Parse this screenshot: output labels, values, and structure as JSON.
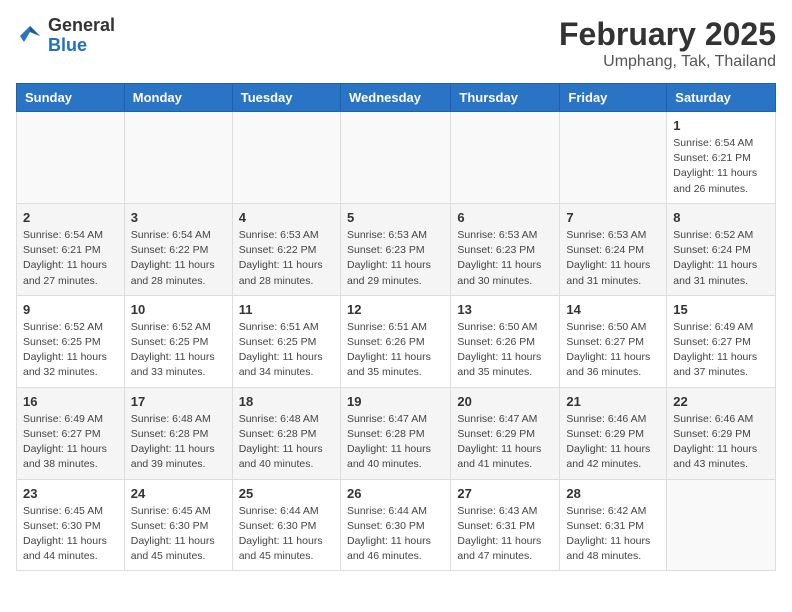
{
  "logo": {
    "general": "General",
    "blue": "Blue"
  },
  "title": "February 2025",
  "subtitle": "Umphang, Tak, Thailand",
  "days_of_week": [
    "Sunday",
    "Monday",
    "Tuesday",
    "Wednesday",
    "Thursday",
    "Friday",
    "Saturday"
  ],
  "weeks": [
    [
      {
        "day": "",
        "info": ""
      },
      {
        "day": "",
        "info": ""
      },
      {
        "day": "",
        "info": ""
      },
      {
        "day": "",
        "info": ""
      },
      {
        "day": "",
        "info": ""
      },
      {
        "day": "",
        "info": ""
      },
      {
        "day": "1",
        "info": "Sunrise: 6:54 AM\nSunset: 6:21 PM\nDaylight: 11 hours and 26 minutes."
      }
    ],
    [
      {
        "day": "2",
        "info": "Sunrise: 6:54 AM\nSunset: 6:21 PM\nDaylight: 11 hours and 27 minutes."
      },
      {
        "day": "3",
        "info": "Sunrise: 6:54 AM\nSunset: 6:22 PM\nDaylight: 11 hours and 28 minutes."
      },
      {
        "day": "4",
        "info": "Sunrise: 6:53 AM\nSunset: 6:22 PM\nDaylight: 11 hours and 28 minutes."
      },
      {
        "day": "5",
        "info": "Sunrise: 6:53 AM\nSunset: 6:23 PM\nDaylight: 11 hours and 29 minutes."
      },
      {
        "day": "6",
        "info": "Sunrise: 6:53 AM\nSunset: 6:23 PM\nDaylight: 11 hours and 30 minutes."
      },
      {
        "day": "7",
        "info": "Sunrise: 6:53 AM\nSunset: 6:24 PM\nDaylight: 11 hours and 31 minutes."
      },
      {
        "day": "8",
        "info": "Sunrise: 6:52 AM\nSunset: 6:24 PM\nDaylight: 11 hours and 31 minutes."
      }
    ],
    [
      {
        "day": "9",
        "info": "Sunrise: 6:52 AM\nSunset: 6:25 PM\nDaylight: 11 hours and 32 minutes."
      },
      {
        "day": "10",
        "info": "Sunrise: 6:52 AM\nSunset: 6:25 PM\nDaylight: 11 hours and 33 minutes."
      },
      {
        "day": "11",
        "info": "Sunrise: 6:51 AM\nSunset: 6:25 PM\nDaylight: 11 hours and 34 minutes."
      },
      {
        "day": "12",
        "info": "Sunrise: 6:51 AM\nSunset: 6:26 PM\nDaylight: 11 hours and 35 minutes."
      },
      {
        "day": "13",
        "info": "Sunrise: 6:50 AM\nSunset: 6:26 PM\nDaylight: 11 hours and 35 minutes."
      },
      {
        "day": "14",
        "info": "Sunrise: 6:50 AM\nSunset: 6:27 PM\nDaylight: 11 hours and 36 minutes."
      },
      {
        "day": "15",
        "info": "Sunrise: 6:49 AM\nSunset: 6:27 PM\nDaylight: 11 hours and 37 minutes."
      }
    ],
    [
      {
        "day": "16",
        "info": "Sunrise: 6:49 AM\nSunset: 6:27 PM\nDaylight: 11 hours and 38 minutes."
      },
      {
        "day": "17",
        "info": "Sunrise: 6:48 AM\nSunset: 6:28 PM\nDaylight: 11 hours and 39 minutes."
      },
      {
        "day": "18",
        "info": "Sunrise: 6:48 AM\nSunset: 6:28 PM\nDaylight: 11 hours and 40 minutes."
      },
      {
        "day": "19",
        "info": "Sunrise: 6:47 AM\nSunset: 6:28 PM\nDaylight: 11 hours and 40 minutes."
      },
      {
        "day": "20",
        "info": "Sunrise: 6:47 AM\nSunset: 6:29 PM\nDaylight: 11 hours and 41 minutes."
      },
      {
        "day": "21",
        "info": "Sunrise: 6:46 AM\nSunset: 6:29 PM\nDaylight: 11 hours and 42 minutes."
      },
      {
        "day": "22",
        "info": "Sunrise: 6:46 AM\nSunset: 6:29 PM\nDaylight: 11 hours and 43 minutes."
      }
    ],
    [
      {
        "day": "23",
        "info": "Sunrise: 6:45 AM\nSunset: 6:30 PM\nDaylight: 11 hours and 44 minutes."
      },
      {
        "day": "24",
        "info": "Sunrise: 6:45 AM\nSunset: 6:30 PM\nDaylight: 11 hours and 45 minutes."
      },
      {
        "day": "25",
        "info": "Sunrise: 6:44 AM\nSunset: 6:30 PM\nDaylight: 11 hours and 45 minutes."
      },
      {
        "day": "26",
        "info": "Sunrise: 6:44 AM\nSunset: 6:30 PM\nDaylight: 11 hours and 46 minutes."
      },
      {
        "day": "27",
        "info": "Sunrise: 6:43 AM\nSunset: 6:31 PM\nDaylight: 11 hours and 47 minutes."
      },
      {
        "day": "28",
        "info": "Sunrise: 6:42 AM\nSunset: 6:31 PM\nDaylight: 11 hours and 48 minutes."
      },
      {
        "day": "",
        "info": ""
      }
    ]
  ]
}
